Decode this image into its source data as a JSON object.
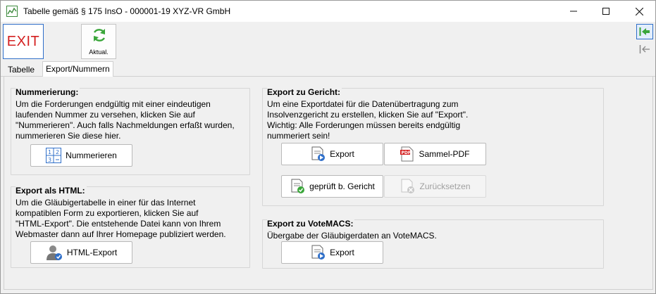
{
  "window": {
    "title": "Tabelle gemäß § 175 InsO - 000001-19 XYZ-VR GmbH",
    "minimize": "—",
    "maximize": "☐",
    "close": "✕"
  },
  "toolbar": {
    "exit_label": "EXIT",
    "refresh_label": "Aktual."
  },
  "tabs": [
    {
      "label": "Tabelle",
      "active": false
    },
    {
      "label": "Export/Nummern",
      "active": true
    }
  ],
  "nummerierung": {
    "title": "Nummerierung:",
    "text": [
      "Um die Forderungen endgültig mit einer eindeutigen",
      "laufenden Nummer zu versehen, klicken Sie auf",
      "\"Nummerieren\". Auch falls Nachmeldungen erfaßt wurden,",
      "nummerieren Sie diese hier."
    ],
    "button": "Nummerieren"
  },
  "export_html": {
    "title": "Export als HTML:",
    "text": [
      "Um die Gläubigertabelle in einer für das Internet",
      "kompatiblen Form zu exportieren, klicken Sie auf",
      "\"HTML-Export\". Die entstehende Datei kann von Ihrem",
      "Webmaster dann auf Ihrer Homepage publiziert werden."
    ],
    "button": "HTML-Export"
  },
  "export_gericht": {
    "title": "Export zu Gericht:",
    "text": [
      "Um eine Exportdatei für die Datenübertragung zum",
      "Insolvenzgericht zu erstellen, klicken Sie auf \"Export\".",
      "Wichtig: Alle Forderungen müssen bereits endgültig",
      "nummeriert sein!"
    ],
    "export_button": "Export",
    "sammel_pdf_button": "Sammel-PDF",
    "geprueft_button": "geprüft b. Gericht",
    "zuruecksetzen_button": "Zurücksetzen"
  },
  "export_votemacs": {
    "title": "Export zu VoteMACS:",
    "text": "Übergabe der Gläubigerdaten an VoteMACS.",
    "button": "Export"
  },
  "colors": {
    "exit_red": "#d42020",
    "accent_green": "#3aa63a",
    "selection_blue": "#2f6fc9"
  }
}
